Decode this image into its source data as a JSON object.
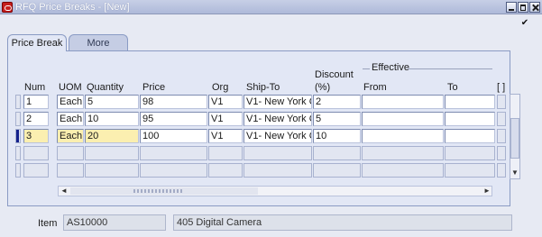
{
  "window": {
    "title": "RFQ Price Breaks - [New]",
    "corner_check": "✔"
  },
  "tabs": [
    {
      "label": "Price Break",
      "active": true
    },
    {
      "label": "More",
      "active": false
    }
  ],
  "columns": {
    "num": "Num",
    "uom": "UOM",
    "quantity": "Quantity",
    "price": "Price",
    "org": "Org",
    "ship_to": "Ship-To",
    "discount_line1": "Discount",
    "discount_line2": "(%)",
    "effective": "Effective",
    "from": "From",
    "to": "To",
    "dfb": "[ ]"
  },
  "rows": [
    {
      "num": "1",
      "uom": "Each",
      "quantity": "5",
      "price": "98",
      "org": "V1",
      "ship_to": "V1- New York C",
      "discount": "2",
      "from": "",
      "to": ""
    },
    {
      "num": "2",
      "uom": "Each",
      "quantity": "10",
      "price": "95",
      "org": "V1",
      "ship_to": "V1- New York C",
      "discount": "5",
      "from": "",
      "to": ""
    },
    {
      "num": "3",
      "uom": "Each",
      "quantity": "20",
      "price": "100",
      "org": "V1",
      "ship_to": "V1- New York C",
      "discount": "10",
      "from": "",
      "to": ""
    }
  ],
  "current_row_index": 2,
  "icons": {
    "app": "oracle-app-icon",
    "minimize": "minimize-icon",
    "maximize": "maximize-icon",
    "close": "close-icon",
    "scroll_up": "▲",
    "scroll_down": "▼",
    "scroll_left": "◄",
    "scroll_right": "►"
  },
  "item": {
    "label": "Item",
    "code": "AS10000",
    "description": "405 Digital Camera"
  },
  "colors": {
    "current_field": "#fbefb0",
    "record_indicator": "#14218c",
    "panel": "#e2e7f5"
  }
}
